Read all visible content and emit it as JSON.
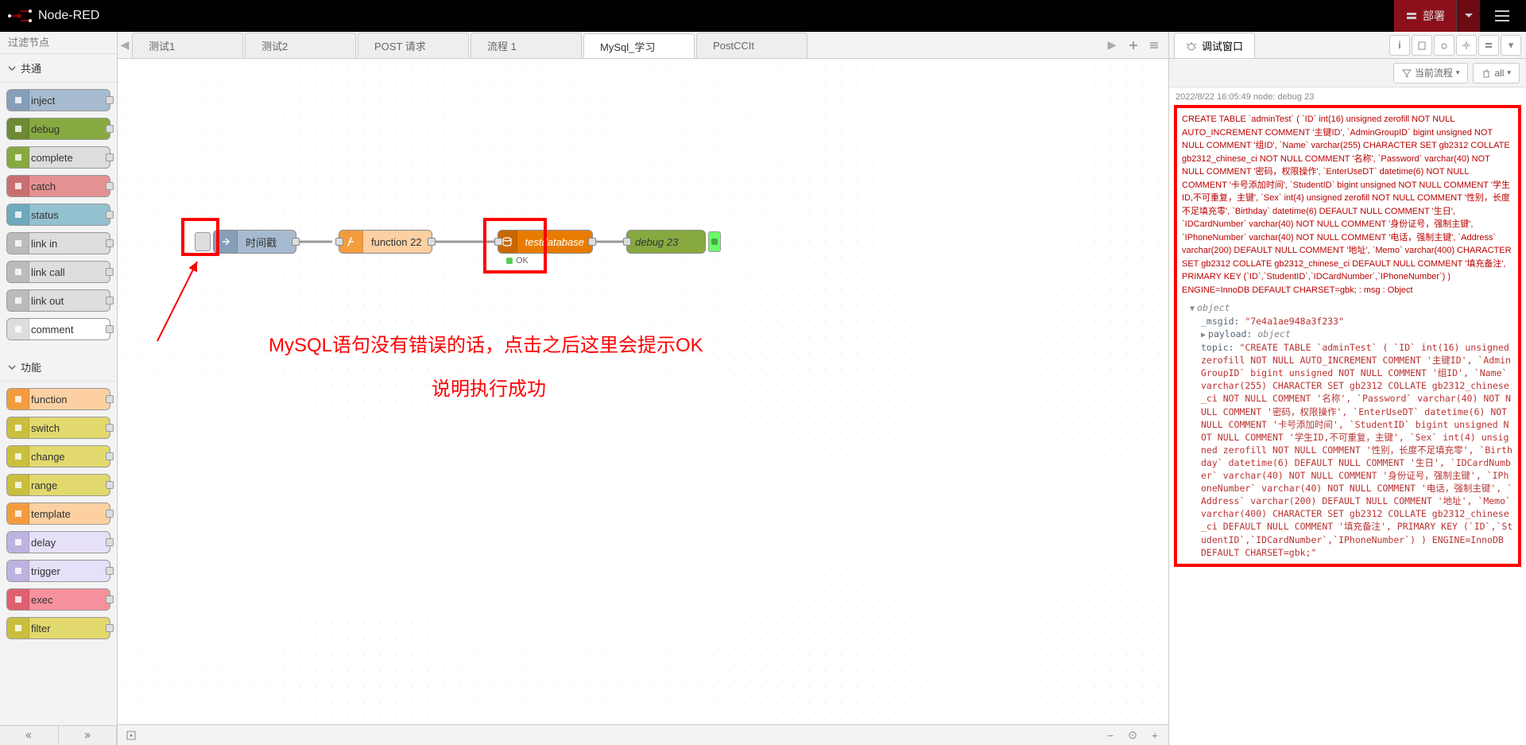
{
  "header": {
    "title": "Node-RED",
    "deploy_label": "部署"
  },
  "palette": {
    "search_placeholder": "过滤节点",
    "categories": {
      "common": "共通",
      "function": "功能"
    },
    "common_nodes": [
      {
        "label": "inject",
        "color": "#a6bbcf",
        "icon_color": "#869eb8"
      },
      {
        "label": "debug",
        "color": "#87a940",
        "icon_color": "#6d8a34"
      },
      {
        "label": "complete",
        "color": "#ddd",
        "icon_color": "#87a940"
      },
      {
        "label": "catch",
        "color": "#e49191",
        "icon_color": "#c96f6f"
      },
      {
        "label": "status",
        "color": "#94c1d0",
        "icon_color": "#6fa9bc"
      },
      {
        "label": "link in",
        "color": "#ddd",
        "icon_color": "#bbb"
      },
      {
        "label": "link call",
        "color": "#ddd",
        "icon_color": "#bbb"
      },
      {
        "label": "link out",
        "color": "#ddd",
        "icon_color": "#bbb"
      },
      {
        "label": "comment",
        "color": "#fff",
        "icon_color": "#ddd"
      }
    ],
    "function_nodes": [
      {
        "label": "function",
        "color": "#fdd0a2",
        "icon_color": "#f39c3f"
      },
      {
        "label": "switch",
        "color": "#e2d96e",
        "icon_color": "#cabe3f"
      },
      {
        "label": "change",
        "color": "#e2d96e",
        "icon_color": "#cabe3f"
      },
      {
        "label": "range",
        "color": "#e2d96e",
        "icon_color": "#cabe3f"
      },
      {
        "label": "template",
        "color": "#fdd0a2",
        "icon_color": "#f39c3f"
      },
      {
        "label": "delay",
        "color": "#e6e0f8",
        "icon_color": "#bdb2e0"
      },
      {
        "label": "trigger",
        "color": "#e6e0f8",
        "icon_color": "#bdb2e0"
      },
      {
        "label": "exec",
        "color": "#f7919e",
        "icon_color": "#e0606f"
      },
      {
        "label": "filter",
        "color": "#e2d96e",
        "icon_color": "#cabe3f"
      }
    ]
  },
  "tabs": [
    {
      "label": "测试1"
    },
    {
      "label": "测试2"
    },
    {
      "label": "POST 请求"
    },
    {
      "label": "流程 1"
    },
    {
      "label": "MySql_学习",
      "active": true
    },
    {
      "label": "PostCCIt"
    }
  ],
  "canvas": {
    "inject_node": {
      "label": "时间戳"
    },
    "function_node": {
      "label": "function 22"
    },
    "db_node": {
      "label": "testdatabase",
      "status": "OK"
    },
    "debug_node": {
      "label": "debug 23"
    }
  },
  "annotations": {
    "line1": "MySQL语句没有错误的话，点击之后这里会提示OK",
    "line2": "说明执行成功"
  },
  "sidebar": {
    "tab_label": "调试窗口",
    "filter_label": "当前流程",
    "trash_label": "all",
    "msg_meta": "2022/8/22 16:05:49   node: debug 23",
    "sql_text": "CREATE TABLE `adminTest` ( `ID` int(16) unsigned zerofill NOT NULL AUTO_INCREMENT COMMENT '主键ID', `AdminGroupID` bigint unsigned NOT NULL COMMENT '组ID', `Name` varchar(255) CHARACTER SET gb2312 COLLATE gb2312_chinese_ci NOT NULL COMMENT '名称', `Password` varchar(40) NOT NULL COMMENT '密码，权限操作', `EnterUseDT` datetime(6) NOT NULL COMMENT '卡号添加时间', `StudentID` bigint unsigned NOT NULL COMMENT '学生ID,不可重复，主键', `Sex` int(4) unsigned zerofill NOT NULL COMMENT '性别，长度不足填充零', `Birthday` datetime(6) DEFAULT NULL COMMENT '生日', `IDCardNumber` varchar(40) NOT NULL COMMENT '身份证号，强制主键', `IPhoneNumber` varchar(40) NOT NULL COMMENT '电话，强制主键', `Address` varchar(200) DEFAULT NULL COMMENT '地址', `Memo` varchar(400) CHARACTER SET gb2312 COLLATE gb2312_chinese_ci DEFAULT NULL COMMENT '填充备注', PRIMARY KEY (`ID`,`StudentID`,`IDCardNumber`,`IPhoneNumber`) ) ENGINE=InnoDB DEFAULT CHARSET=gbk; : msg : Object",
    "object_label": "object",
    "msgid_key": "_msgid:",
    "msgid_val": "\"7e4a1ae948a3f233\"",
    "payload_key": "payload:",
    "payload_type": "object",
    "topic_key": "topic:",
    "topic_val": "\"CREATE TABLE `adminTest` (   `ID` int(16) unsigned zerofill NOT NULL AUTO_INCREMENT COMMENT '主键ID',   `AdminGroupID` bigint unsigned NOT NULL COMMENT '组ID',   `Name` varchar(255) CHARACTER SET gb2312 COLLATE gb2312_chinese_ci NOT NULL COMMENT '名称',   `Password` varchar(40) NOT NULL COMMENT '密码，权限操作',   `EnterUseDT` datetime(6) NOT NULL COMMENT '卡号添加时间',   `StudentID` bigint unsigned NOT NULL COMMENT '学生ID,不可重复，主键',   `Sex` int(4) unsigned zerofill NOT NULL COMMENT '性别，长度不足填充零',   `Birthday` datetime(6) DEFAULT NULL COMMENT '生日',   `IDCardNumber` varchar(40) NOT NULL COMMENT '身份证号，强制主键',   `IPhoneNumber` varchar(40) NOT NULL COMMENT '电话，强制主键',   `Address` varchar(200) DEFAULT NULL COMMENT '地址',   `Memo` varchar(400) CHARACTER SET gb2312 COLLATE gb2312_chinese_ci DEFAULT NULL COMMENT '填充备注',   PRIMARY KEY (`ID`,`StudentID`,`IDCardNumber`,`IPhoneNumber`) ) ENGINE=InnoDB DEFAULT CHARSET=gbk;\""
  }
}
